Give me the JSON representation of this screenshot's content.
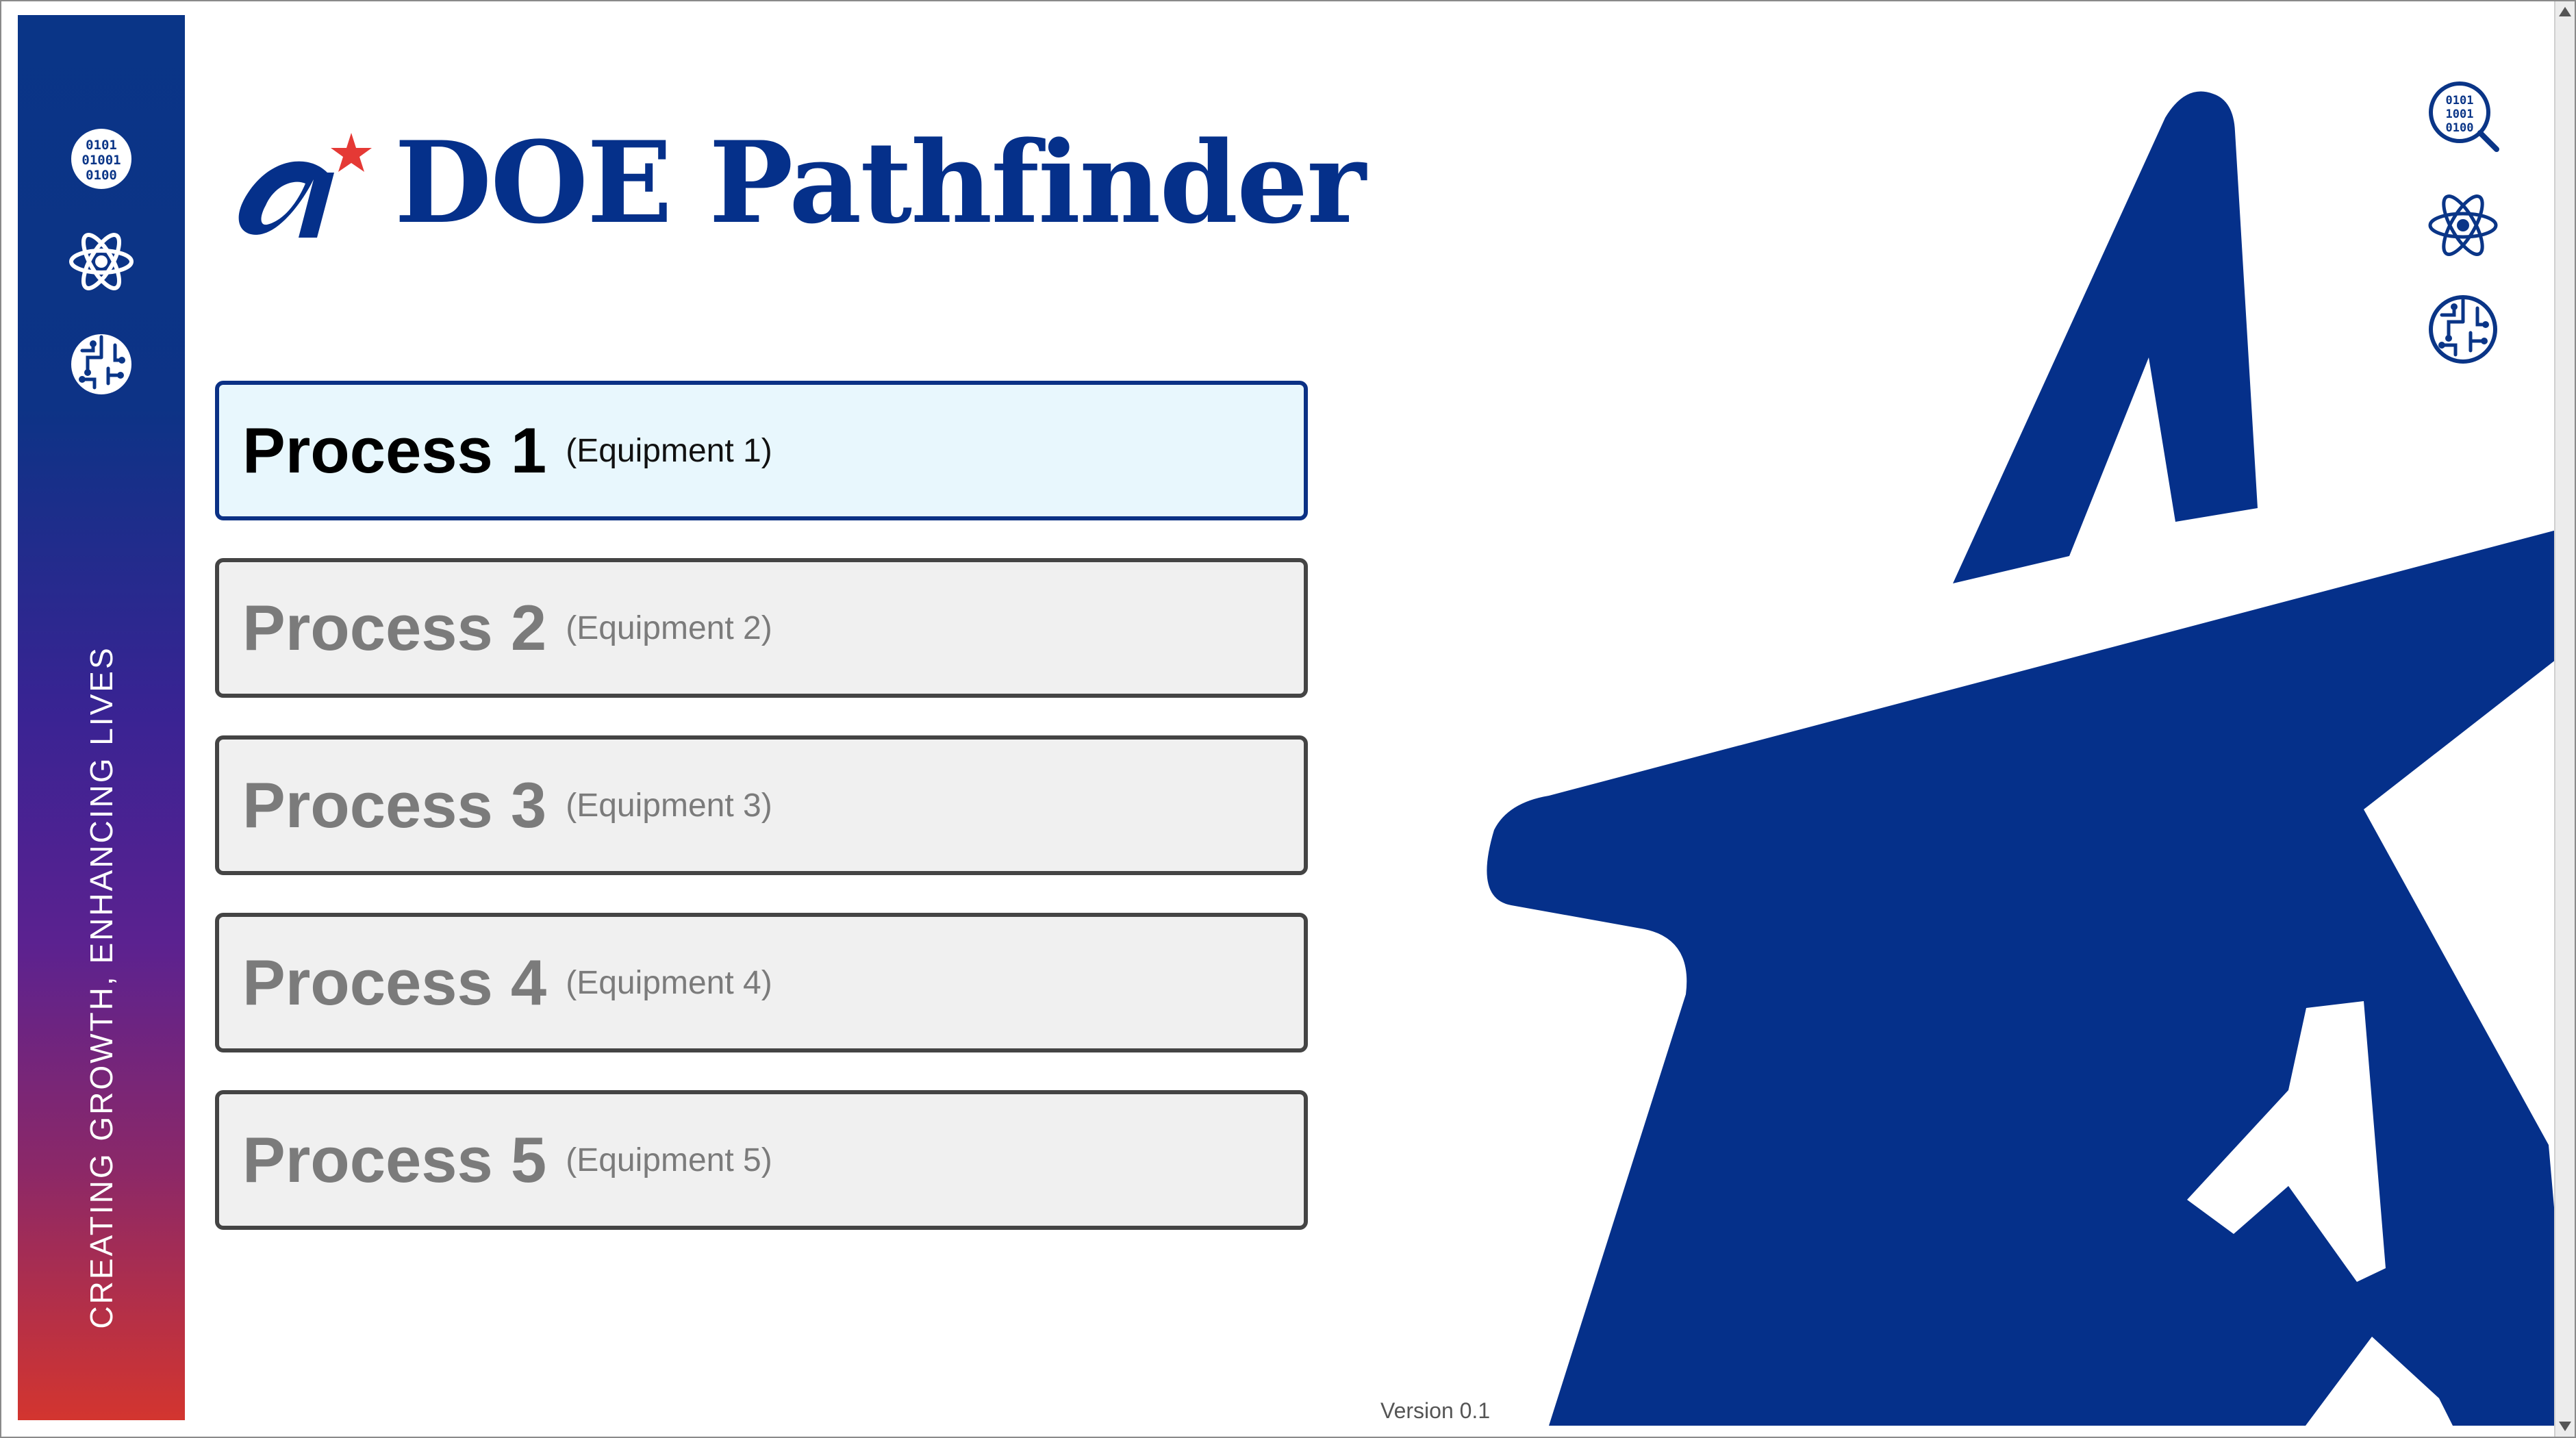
{
  "app": {
    "title": "DOE Pathfinder",
    "tagline": "CREATING GROWTH, ENHANCING LIVES",
    "version": "Version 0.1",
    "brand_color": "#05308a",
    "accent_color": "#e53935"
  },
  "sidebar": {
    "icons": [
      "binary-code-icon",
      "atom-icon",
      "circuit-brain-icon"
    ]
  },
  "right_toolbar": {
    "icons": [
      "binary-search-icon",
      "atom-icon",
      "circuit-brain-icon"
    ]
  },
  "processes": [
    {
      "name": "Process 1",
      "equipment": "(Equipment 1)",
      "active": true
    },
    {
      "name": "Process 2",
      "equipment": "(Equipment 2)",
      "active": false
    },
    {
      "name": "Process 3",
      "equipment": "(Equipment 3)",
      "active": false
    },
    {
      "name": "Process 4",
      "equipment": "(Equipment 4)",
      "active": false
    },
    {
      "name": "Process 5",
      "equipment": "(Equipment 5)",
      "active": false
    }
  ]
}
